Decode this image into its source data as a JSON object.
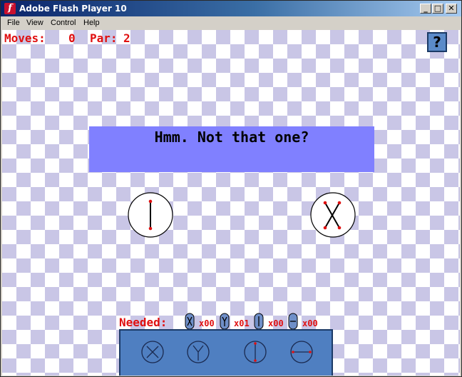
{
  "window": {
    "title": "Adobe Flash Player 10",
    "minimize": "_",
    "maximize": "□",
    "close": "✕"
  },
  "menu": [
    "File",
    "View",
    "Control",
    "Help"
  ],
  "hud": {
    "moves_label": "Moves:",
    "moves_value": "0",
    "par_label": "Par:",
    "par_value": "2",
    "help": "?"
  },
  "message": "Hmm. Not that one?",
  "orbs": [
    {
      "name": "current-orb",
      "pattern": "vertical-line"
    },
    {
      "name": "target-orb",
      "pattern": "x-cross"
    }
  ],
  "needed": {
    "label": "Needed:",
    "items": [
      {
        "icon": "x-tile-icon",
        "count": "x00"
      },
      {
        "icon": "y-tile-icon",
        "count": "x01"
      },
      {
        "icon": "vertical-tile-icon",
        "count": "x00"
      },
      {
        "icon": "horizontal-tile-icon",
        "count": "x00"
      }
    ]
  },
  "tray": [
    {
      "icon": "x-move-icon"
    },
    {
      "icon": "y-move-icon"
    },
    {
      "icon": "vertical-move-icon"
    },
    {
      "icon": "horizontal-move-icon"
    }
  ],
  "colors": {
    "hud_red": "#e01010",
    "message_bg": "#8080ff",
    "tray_bg": "#4f7fc1",
    "checker": "#c9c6e6"
  }
}
